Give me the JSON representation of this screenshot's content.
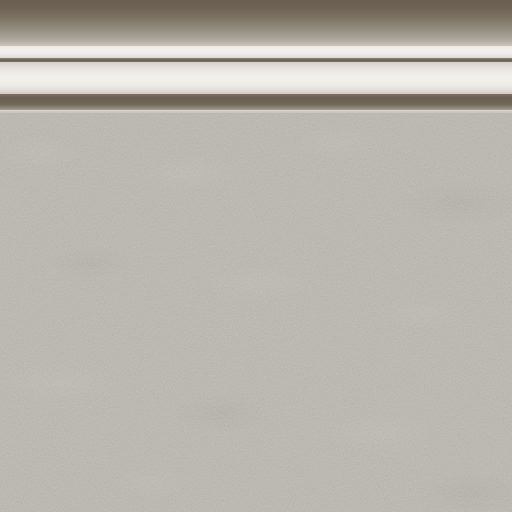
{
  "texture": {
    "type": "wall-with-crown-molding",
    "colors": {
      "molding_dark": "#6a5f52",
      "molding_light": "#f2f0ec",
      "wall": "#bcb8b1"
    }
  }
}
